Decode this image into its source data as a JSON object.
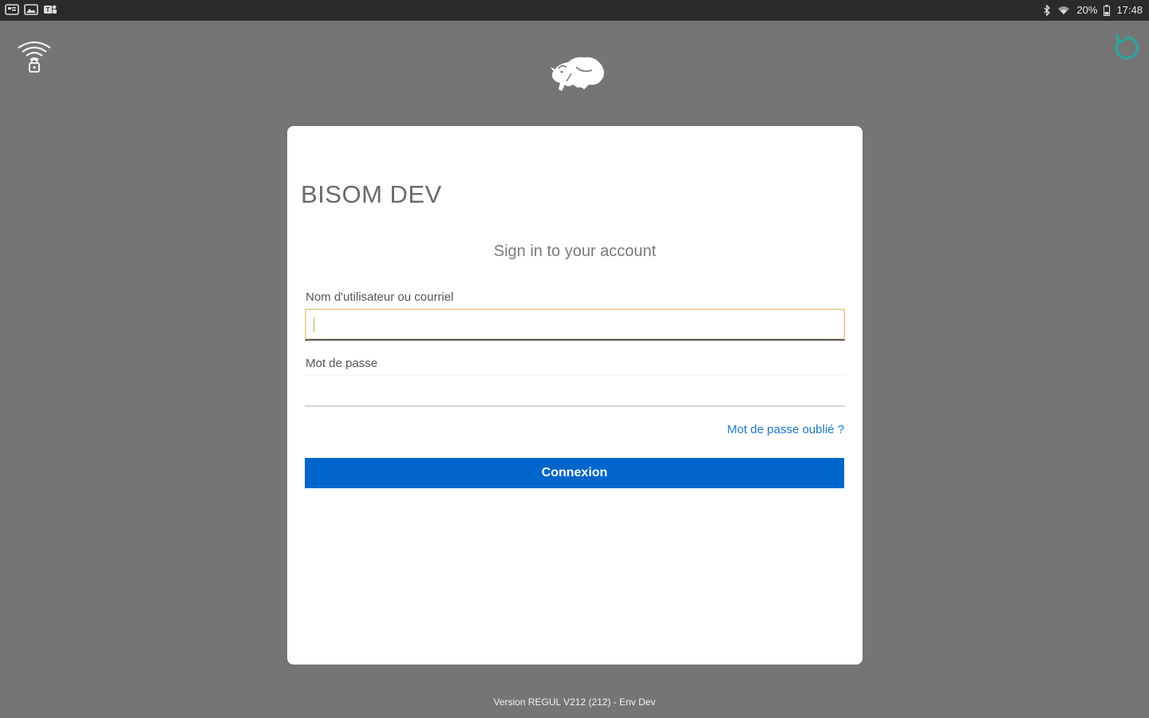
{
  "status_bar": {
    "left_icons": [
      "notification-app-icon",
      "gallery-icon",
      "teams-icon"
    ],
    "right_text": "20%",
    "time": "17:48",
    "icons": [
      "bluetooth-icon",
      "wifi-icon",
      "battery-icon"
    ]
  },
  "header": {
    "left_icon": "wifi-lock-icon",
    "center_logo": "bison-logo",
    "right_icon": "refresh-icon",
    "accent_color": "#2aa7a0"
  },
  "login": {
    "realm_title": "BISOM DEV",
    "subtitle": "Sign in to your account",
    "username_label": "Nom d'utilisateur ou courriel",
    "username_value": "",
    "password_label": "Mot de passe",
    "password_value": "",
    "forgot_link": "Mot de passe oublié ?",
    "submit_label": "Connexion",
    "primary_color": "#0066cc"
  },
  "footer": {
    "version_text": "Version REGUL V212 (212) - Env Dev"
  }
}
